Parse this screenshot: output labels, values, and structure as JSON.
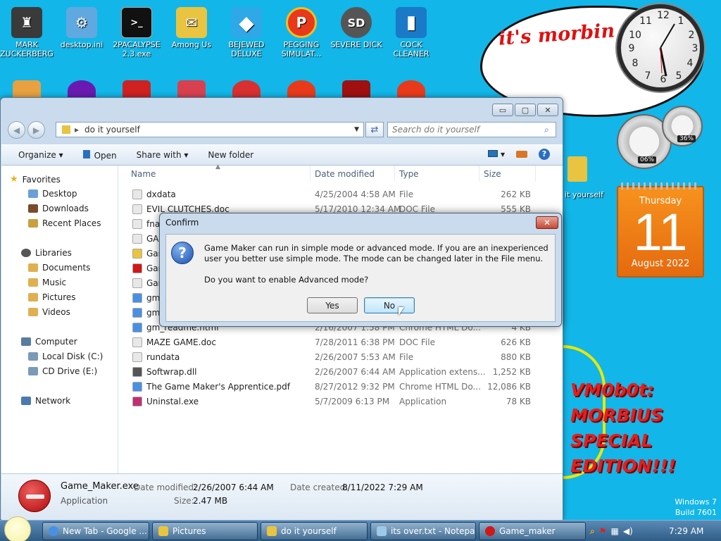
{
  "desktop": {
    "icons": [
      {
        "label": "MARK ZUCKERBERG",
        "glyph": "♜",
        "color": "#3a3a3a"
      },
      {
        "label": "desktop.ini",
        "glyph": "⚙",
        "color": "#5fa8e0"
      },
      {
        "label": "2PACALYPSE 2.3.exe",
        "glyph": ">_",
        "color": "#111111"
      },
      {
        "label": "Among Us",
        "glyph": "✉",
        "color": "#e8c440"
      },
      {
        "label": "BEJEWED DELUXE",
        "glyph": "◆",
        "color": "#2fa8e8"
      },
      {
        "label": "PEGGING SIMULAT...",
        "glyph": "P",
        "color": "#e83a1a"
      },
      {
        "label": "SEVERE DICK",
        "glyph": "SD",
        "color": "#555555"
      },
      {
        "label": "COCK CLEANER",
        "glyph": "▮",
        "color": "#1a7ac8"
      }
    ],
    "partial_icon_label": "it yourself",
    "bubble_text": "it's morbin",
    "clock_numbers": [
      "12",
      "1",
      "2",
      "3",
      "4",
      "5",
      "6",
      "7",
      "8",
      "9",
      "10",
      "11"
    ],
    "gauge_left": "06%",
    "gauge_right": "36%",
    "calendar": {
      "day": "Thursday",
      "date": "11",
      "month": "August 2022"
    },
    "morbius_text": "VM0b0t:\nMORBIUS\nSPECIAL\nEDITION!!!",
    "watermark_line1": "Windows 7",
    "watermark_line2": "Build 7601",
    "accent": "#12b6e8"
  },
  "explorer": {
    "caption": {
      "min": "▭",
      "max": "▢",
      "close": "✕"
    },
    "address": "do it yourself",
    "search_placeholder": "Search do it yourself",
    "toolbar": {
      "organize": "Organize",
      "open": "Open",
      "share": "Share with",
      "newfolder": "New folder"
    },
    "sidebar": {
      "favorites": "Favorites",
      "desktop": "Desktop",
      "downloads": "Downloads",
      "recent": "Recent Places",
      "libraries": "Libraries",
      "documents": "Documents",
      "music": "Music",
      "pictures": "Pictures",
      "videos": "Videos",
      "computer": "Computer",
      "localdisk": "Local Disk (C:)",
      "cddrive": "CD Drive (E:)",
      "network": "Network"
    },
    "columns": {
      "name": "Name",
      "date": "Date modified",
      "type": "Type",
      "size": "Size"
    },
    "files": [
      {
        "name": "dxdata",
        "date": "4/25/2004 4:58 AM",
        "type": "File",
        "size": "262 KB",
        "icon": "#e8e8e8"
      },
      {
        "name": "EVIL CLUTCHES.doc",
        "date": "5/17/2010 12:34 AM",
        "type": "DOC File",
        "size": "555 KB",
        "icon": "#e8e8e8"
      },
      {
        "name": "fnar",
        "date": "",
        "type": "",
        "size": "",
        "icon": "#e8e8e8"
      },
      {
        "name": "GAL",
        "date": "",
        "type": "",
        "size": "",
        "icon": "#e8e8e8"
      },
      {
        "name": "Gan",
        "date": "",
        "type": "",
        "size": "",
        "icon": "#e8c440"
      },
      {
        "name": "Gan",
        "date": "",
        "type": "",
        "size": "",
        "icon": "#d01818"
      },
      {
        "name": "Gan",
        "date": "",
        "type": "",
        "size": "",
        "icon": "#e8e8e8"
      },
      {
        "name": "gm_",
        "date": "",
        "type": "",
        "size": "",
        "icon": "#4a90e2"
      },
      {
        "name": "gm_",
        "date": "",
        "type": "",
        "size": "",
        "icon": "#4a90e2"
      },
      {
        "name": "gm_readme.html",
        "date": "2/16/2007 1:58 PM",
        "type": "Chrome HTML Do...",
        "size": "4 KB",
        "icon": "#4a90e2"
      },
      {
        "name": "MAZE GAME.doc",
        "date": "7/28/2011 6:38 PM",
        "type": "DOC File",
        "size": "626 KB",
        "icon": "#e8e8e8"
      },
      {
        "name": "rundata",
        "date": "2/26/2007 5:53 AM",
        "type": "File",
        "size": "880 KB",
        "icon": "#e8e8e8"
      },
      {
        "name": "Softwrap.dll",
        "date": "2/26/2007 6:44 AM",
        "type": "Application extens...",
        "size": "1,252 KB",
        "icon": "#555555"
      },
      {
        "name": "The Game Maker's Apprentice.pdf",
        "date": "8/27/2012 9:32 PM",
        "type": "Chrome HTML Do...",
        "size": "12,086 KB",
        "icon": "#4a90e2"
      },
      {
        "name": "Uninstal.exe",
        "date": "5/7/2009 6:13 PM",
        "type": "Application",
        "size": "78 KB",
        "icon": "#c03070"
      }
    ],
    "details": {
      "filename": "Game_Maker.exe",
      "type": "Application",
      "modified_label": "Date modified:",
      "modified": "2/26/2007 6:44 AM",
      "created_label": "Date created:",
      "created": "8/11/2022 7:29 AM",
      "size_label": "Size:",
      "size": "2.47 MB"
    }
  },
  "dialog": {
    "title": "Confirm",
    "close": "✕",
    "message": "Game Maker can run in simple mode or advanced mode. If you are an inexperienced user you better use simple mode.  The mode can be changed later in the File menu.",
    "question": "Do you want to enable Advanced mode?",
    "yes": "Yes",
    "no": "No"
  },
  "taskbar": {
    "items": [
      {
        "label": "New Tab - Google ...",
        "icon": "#4a90e2"
      },
      {
        "label": "Pictures",
        "icon": "#e8c440"
      },
      {
        "label": "do it yourself",
        "icon": "#e8c440"
      },
      {
        "label": "its over.txt - Notepad",
        "icon": "#9ec8e8"
      },
      {
        "label": "Game_maker",
        "icon": "#d01818"
      }
    ],
    "time": "7:29 AM"
  }
}
